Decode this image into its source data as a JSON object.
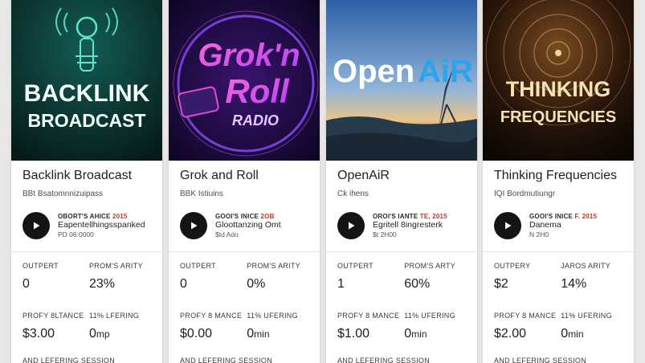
{
  "cards": [
    {
      "cover": {
        "line1": "BACKLINK",
        "line2": "BROADCAST",
        "accent": "#5fe8c8",
        "bg": "#0b2f2d"
      },
      "title": "Backlink Broadcast",
      "subtitle": "BBt Bsatomnnizuipass",
      "episode": {
        "tag": "OBORT'S AHICE",
        "date": "2015",
        "title": "Eapentellhingsspanked",
        "meta": "PD 06:0000"
      },
      "stats": {
        "output_label": "OUTPERT",
        "output_value": "0",
        "progress_label": "PROM'S ARITY",
        "progress_value": "23%",
        "price_label": "PROFY 8LTANCE",
        "price_value": "$3.00",
        "time_label": "11% LFERING",
        "time_value": "0",
        "time_unit": "mp"
      },
      "footer": "AND LEFERING SESSION"
    },
    {
      "cover": {
        "line1": "Grok'n",
        "line2": "Roll",
        "line3": "RADIO",
        "accent": "#e14bd9",
        "bg": "#1a0a36"
      },
      "title": "Grok and Roll",
      "subtitle": "BBK Istiuins",
      "episode": {
        "tag": "GOOI'S INICE",
        "date": "2OB",
        "title": "Gloottanzing Omt",
        "meta": "$td Ado"
      },
      "stats": {
        "output_label": "OUTPERT",
        "output_value": "0",
        "progress_label": "PROM'S ARITY",
        "progress_value": "0%",
        "price_label": "PROFY 8 MANCE",
        "price_value": "$0.00",
        "time_label": "11% UFERING",
        "time_value": "0",
        "time_unit": "min"
      },
      "footer": "AND LEFERING SESSION"
    },
    {
      "cover": {
        "line1": "Open",
        "line2": "AiR",
        "accent": "#1e8fd8",
        "bg": "#3d6fae"
      },
      "title": "OpenAiR",
      "subtitle": "Ck ihens",
      "episode": {
        "tag": "OROI'S IANTE",
        "date": "TE, 2015",
        "title": "Egritell 8ingresterk",
        "meta": "$t 2H00"
      },
      "stats": {
        "output_label": "OUTPERT",
        "output_value": "1",
        "progress_label": "PROM'S ARTY",
        "progress_value": "60%",
        "price_label": "PROFY 8 MANCE",
        "price_value": "$1.00",
        "time_label": "11% UFERING",
        "time_value": "0",
        "time_unit": "min"
      },
      "footer": "AND LEFERING SESSION"
    },
    {
      "cover": {
        "line1": "THINKING",
        "line2": "FREQUENCIES",
        "accent": "#f3e2b4",
        "bg": "#1a0f08"
      },
      "title": "Thinking Frequencies",
      "subtitle": "IQI Bordmutiungr",
      "episode": {
        "tag": "GOOI'S INICE",
        "date": "F. 2015",
        "title": "Danema",
        "meta": "N 2H0"
      },
      "stats": {
        "output_label": "OUTPERY",
        "output_value": "$2",
        "progress_label": "JAROS ARITY",
        "progress_value": "14%",
        "price_label": "PROFY 8 MANCE",
        "price_value": "$2.00",
        "time_label": "11% UFERING",
        "time_value": "0",
        "time_unit": "min"
      },
      "footer": "AND LEFERING SESSION"
    }
  ]
}
